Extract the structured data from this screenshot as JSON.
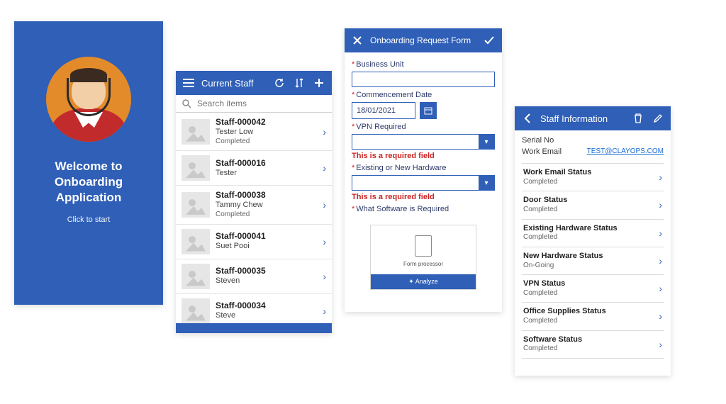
{
  "welcome": {
    "title": "Welcome to Onboarding Application",
    "subtitle": "Click to start"
  },
  "staff_list": {
    "header_title": "Current Staff",
    "search_placeholder": "Search items",
    "items": [
      {
        "id": "Staff-000042",
        "name": "Tester Low",
        "status": "Completed"
      },
      {
        "id": "Staff-000016",
        "name": "Tester",
        "status": ""
      },
      {
        "id": "Staff-000038",
        "name": "Tammy Chew",
        "status": "Completed"
      },
      {
        "id": "Staff-000041",
        "name": "Suet Pooi",
        "status": ""
      },
      {
        "id": "Staff-000035",
        "name": "Steven",
        "status": ""
      },
      {
        "id": "Staff-000034",
        "name": "Steve",
        "status": ""
      }
    ]
  },
  "form": {
    "header_title": "Onboarding Request Form",
    "labels": {
      "business_unit": "Business Unit",
      "commencement": "Commencement Date",
      "vpn": "VPN Required",
      "hardware": "Existing or New Hardware",
      "software": "What Software is Required"
    },
    "values": {
      "commencement": "18/01/2021"
    },
    "error_required": "This is a required field",
    "processor_label": "Form processor",
    "analyze_label": "Analyze"
  },
  "info": {
    "header_title": "Staff Information",
    "serial_label": "Serial No",
    "email_label": "Work Email",
    "email_value": "TEST@CLAYOPS.COM",
    "statuses": [
      {
        "label": "Work Email Status",
        "status": "Completed"
      },
      {
        "label": "Door Status",
        "status": "Completed"
      },
      {
        "label": "Existing Hardware Status",
        "status": "Completed"
      },
      {
        "label": "New Hardware Status",
        "status": "On-Going"
      },
      {
        "label": "VPN Status",
        "status": "Completed"
      },
      {
        "label": "Office Supplies Status",
        "status": "Completed"
      },
      {
        "label": "Software Status",
        "status": "Completed"
      }
    ]
  }
}
